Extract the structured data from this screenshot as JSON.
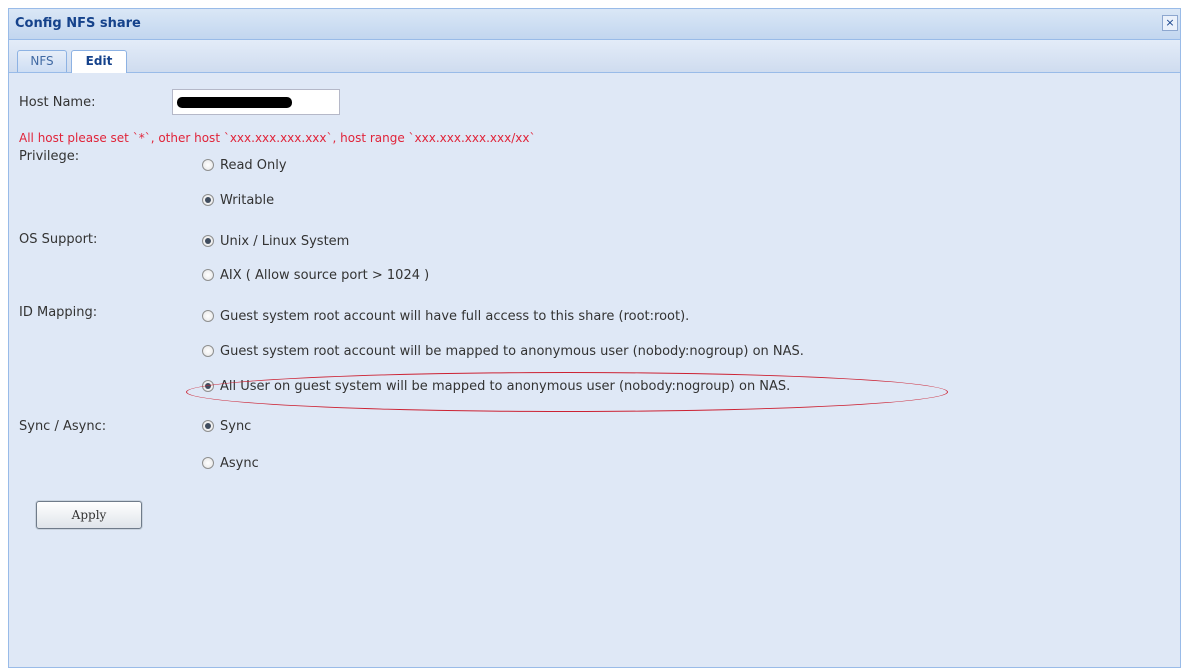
{
  "window": {
    "title": "Config NFS share",
    "close_glyph": "×"
  },
  "tabs": [
    {
      "label": "NFS"
    },
    {
      "label": "Edit"
    }
  ],
  "host": {
    "label": "Host Name:",
    "value": "",
    "hint": "All host please set `*`, other host `xxx.xxx.xxx.xxx`, host range `xxx.xxx.xxx.xxx/xx`"
  },
  "privilege": {
    "label": "Privilege:",
    "options": [
      "Read Only",
      "Writable"
    ],
    "selected": "Writable"
  },
  "os_support": {
    "label": "OS Support:",
    "options": [
      "Unix / Linux System",
      "AIX ( Allow source port > 1024 )"
    ],
    "selected": "Unix / Linux System"
  },
  "id_mapping": {
    "label": "ID Mapping:",
    "options": [
      "Guest system root account will have full access to this share (root:root).",
      "Guest system root account will be mapped to anonymous user (nobody:nogroup) on NAS.",
      "All User on guest system will be mapped to anonymous user (nobody:nogroup) on NAS."
    ],
    "selected": "All User on guest system will be mapped to anonymous user (nobody:nogroup) on NAS."
  },
  "sync": {
    "label": "Sync / Async:",
    "options": [
      "Sync",
      "Async"
    ],
    "selected": "Sync"
  },
  "apply_label": "Apply",
  "colors": {
    "hint": "#e0243a",
    "highlight": "#cc2233",
    "title": "#15428b"
  }
}
